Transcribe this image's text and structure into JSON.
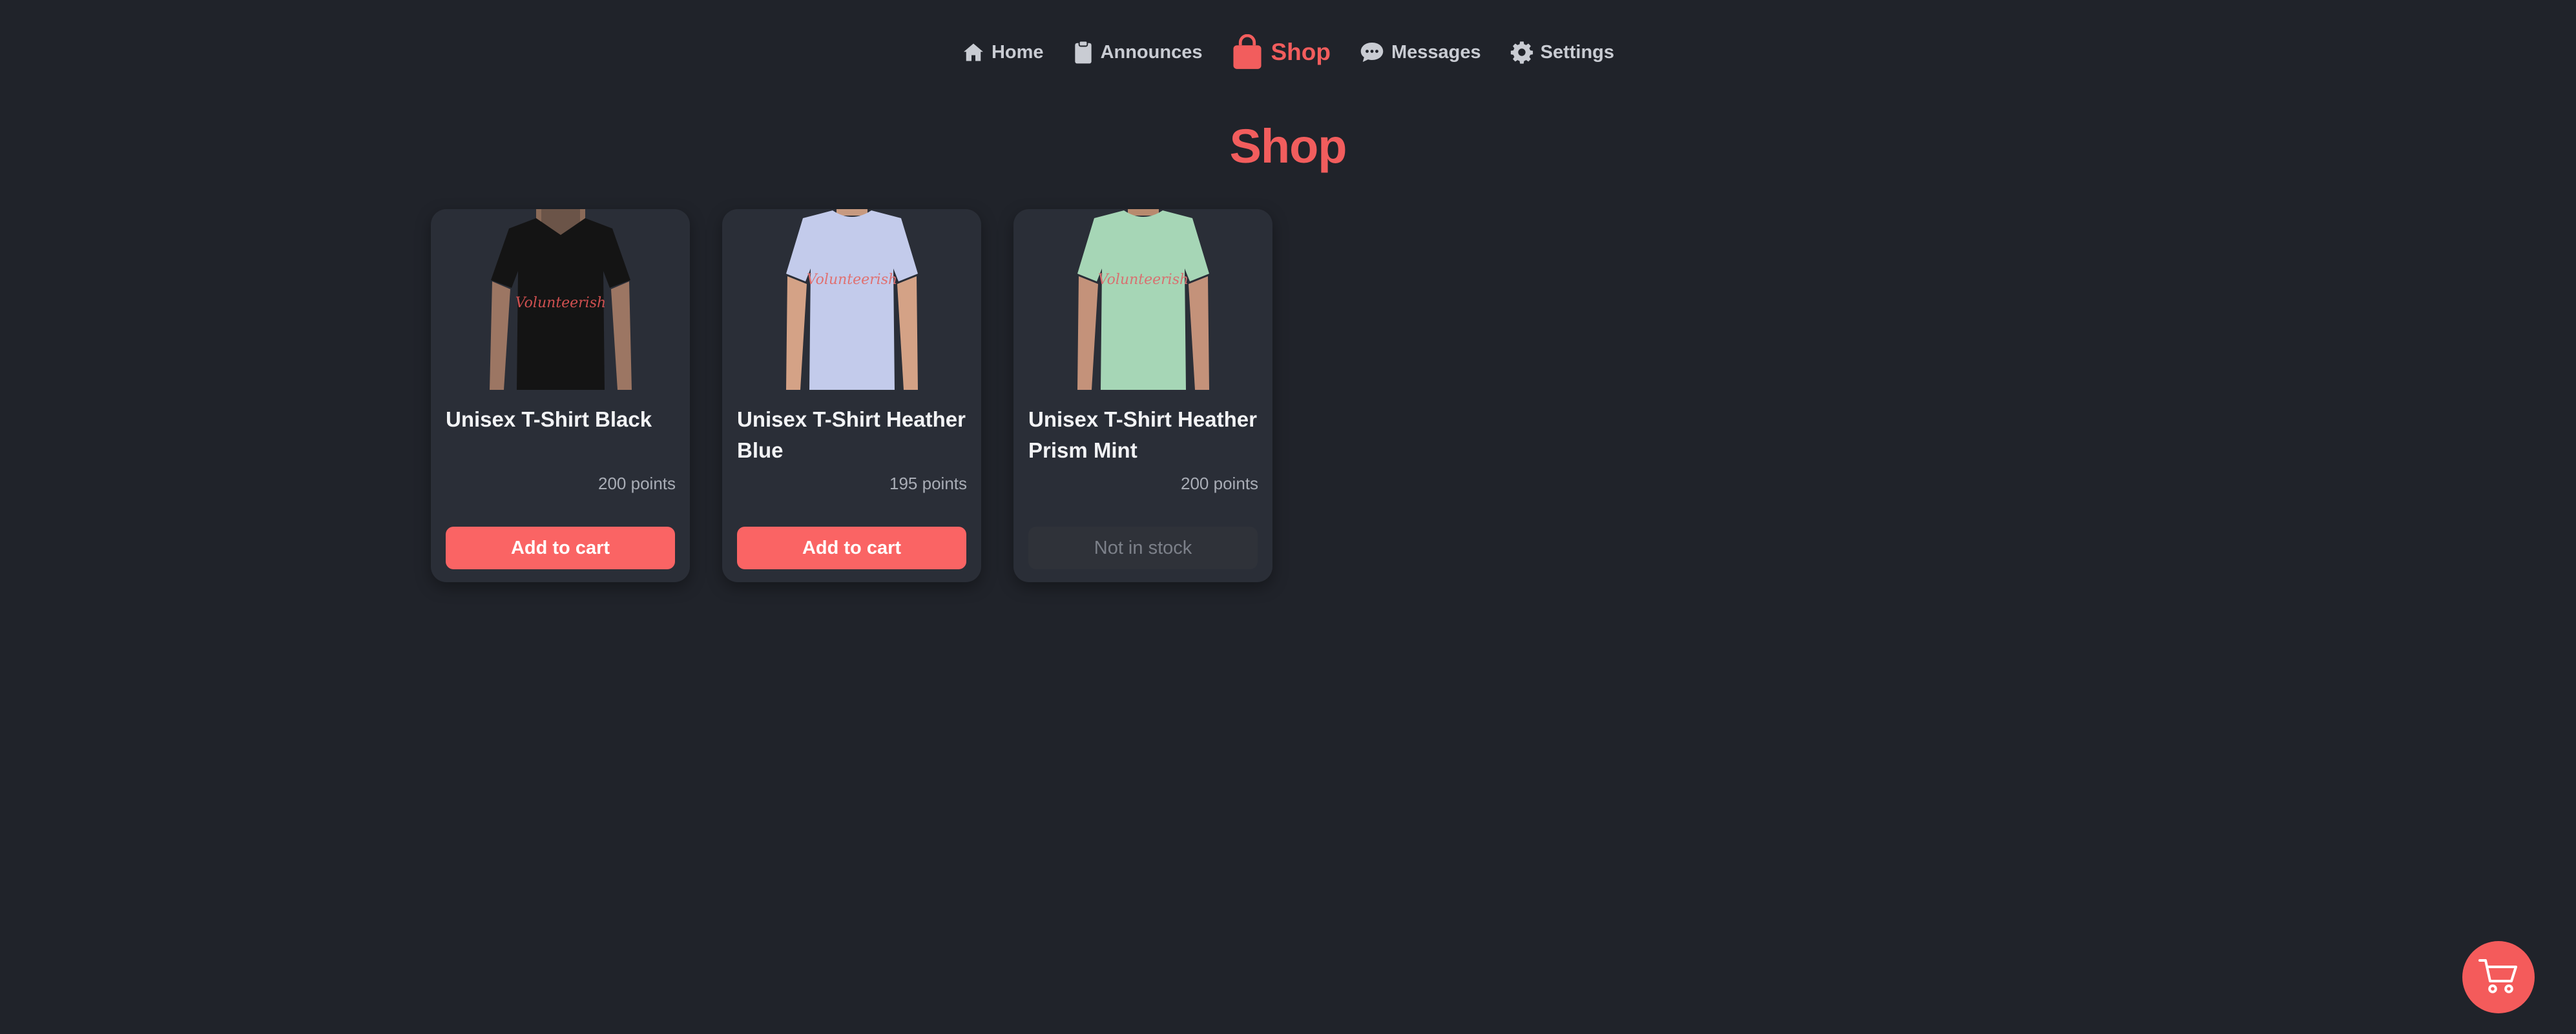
{
  "nav": {
    "items": [
      {
        "label": "Home",
        "icon": "home-icon"
      },
      {
        "label": "Announces",
        "icon": "clipboard-icon"
      },
      {
        "label": "Shop",
        "icon": "shopping-bag-icon",
        "active": true
      },
      {
        "label": "Messages",
        "icon": "chat-bubble-icon"
      },
      {
        "label": "Settings",
        "icon": "gear-icon"
      }
    ]
  },
  "page": {
    "title": "Shop"
  },
  "products": [
    {
      "name": "Unisex T-Shirt Black",
      "price": "200 points",
      "button": "Add to cart",
      "in_stock": true,
      "shirt_color": "#141414"
    },
    {
      "name": "Unisex T-Shirt Heather Blue",
      "price": "195 points",
      "button": "Add to cart",
      "in_stock": true,
      "shirt_color": "#c3cbeb"
    },
    {
      "name": "Unisex T-Shirt Heather Prism Mint",
      "price": "200 points",
      "button": "Not in stock",
      "in_stock": false,
      "shirt_color": "#a6d6b6"
    }
  ],
  "cart": {
    "icon": "shopping-cart-icon"
  },
  "colors": {
    "accent": "#f25d5d",
    "background": "#20232a",
    "card": "#2a2e37"
  }
}
